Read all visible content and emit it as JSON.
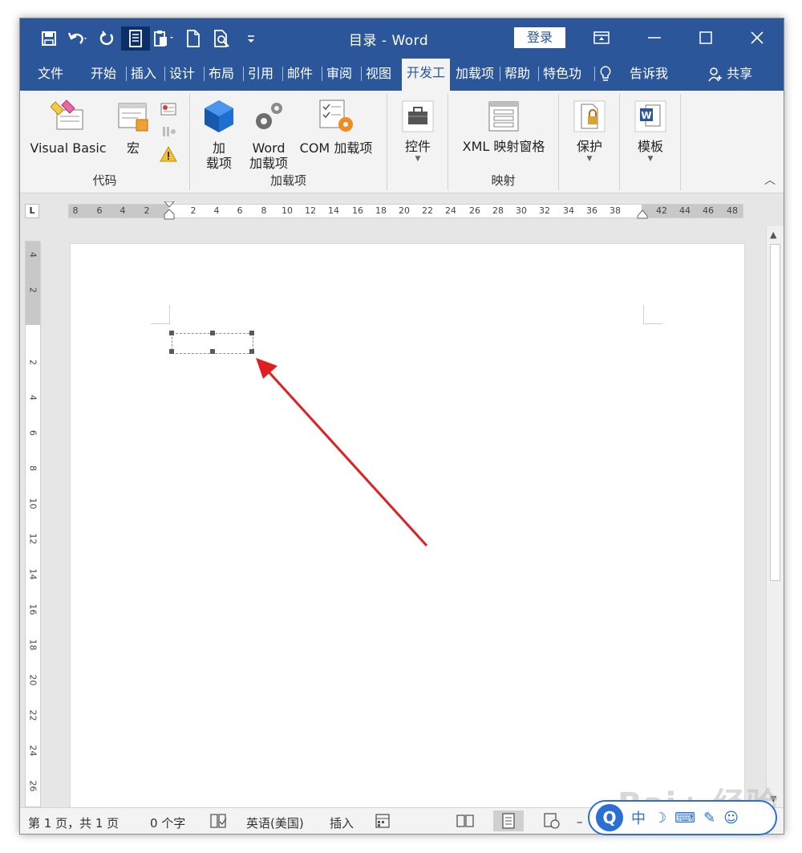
{
  "window": {
    "title": "目录 - Word",
    "login_label": "登录",
    "quick_access": [
      "save-icon",
      "undo-icon",
      "redo-icon",
      "form-icon",
      "paste-icon",
      "new-doc-icon",
      "print-preview-icon",
      "customize-icon"
    ]
  },
  "tabs": [
    {
      "label": "文件"
    },
    {
      "label": "开始"
    },
    {
      "label": "插入"
    },
    {
      "label": "设计"
    },
    {
      "label": "布局"
    },
    {
      "label": "引用"
    },
    {
      "label": "邮件"
    },
    {
      "label": "审阅"
    },
    {
      "label": "视图"
    },
    {
      "label": "开发工",
      "active": true
    },
    {
      "label": "加载项"
    },
    {
      "label": "帮助"
    },
    {
      "label": "特色功"
    },
    {
      "label": "告诉我"
    },
    {
      "label": "共享"
    }
  ],
  "ribbon": {
    "code": {
      "group_label": "代码",
      "visual_basic": "Visual Basic",
      "macro": "宏"
    },
    "addins": {
      "group_label": "加载项",
      "addins_line1": "加",
      "addins_line2": "载项",
      "word_addins_line1": "Word",
      "word_addins_line2": "加载项",
      "com_addins": "COM 加载项"
    },
    "controls": {
      "label": "控件"
    },
    "mapping": {
      "group_label": "映射",
      "xml_pane": "XML 映射窗格"
    },
    "protect": {
      "label": "保护"
    },
    "templates": {
      "label": "模板"
    }
  },
  "ruler": {
    "tab_selector": "L",
    "horizontal": [
      "8",
      "6",
      "4",
      "2",
      "2",
      "4",
      "6",
      "8",
      "10",
      "12",
      "14",
      "16",
      "18",
      "20",
      "22",
      "24",
      "26",
      "28",
      "30",
      "32",
      "34",
      "36",
      "38",
      "42",
      "44",
      "46",
      "48"
    ],
    "vertical": [
      "4",
      "2",
      "2",
      "4",
      "6",
      "8",
      "10",
      "12",
      "14",
      "16",
      "18",
      "20",
      "22",
      "24",
      "26"
    ]
  },
  "status": {
    "page": "第 1 页，共 1 页",
    "words": "0 个字",
    "language": "英语(美国)",
    "mode": "插入"
  },
  "ime": {
    "logo": "Q",
    "mode": "中"
  },
  "colors": {
    "brand": "#2b579a",
    "arrow": "#e02020"
  }
}
